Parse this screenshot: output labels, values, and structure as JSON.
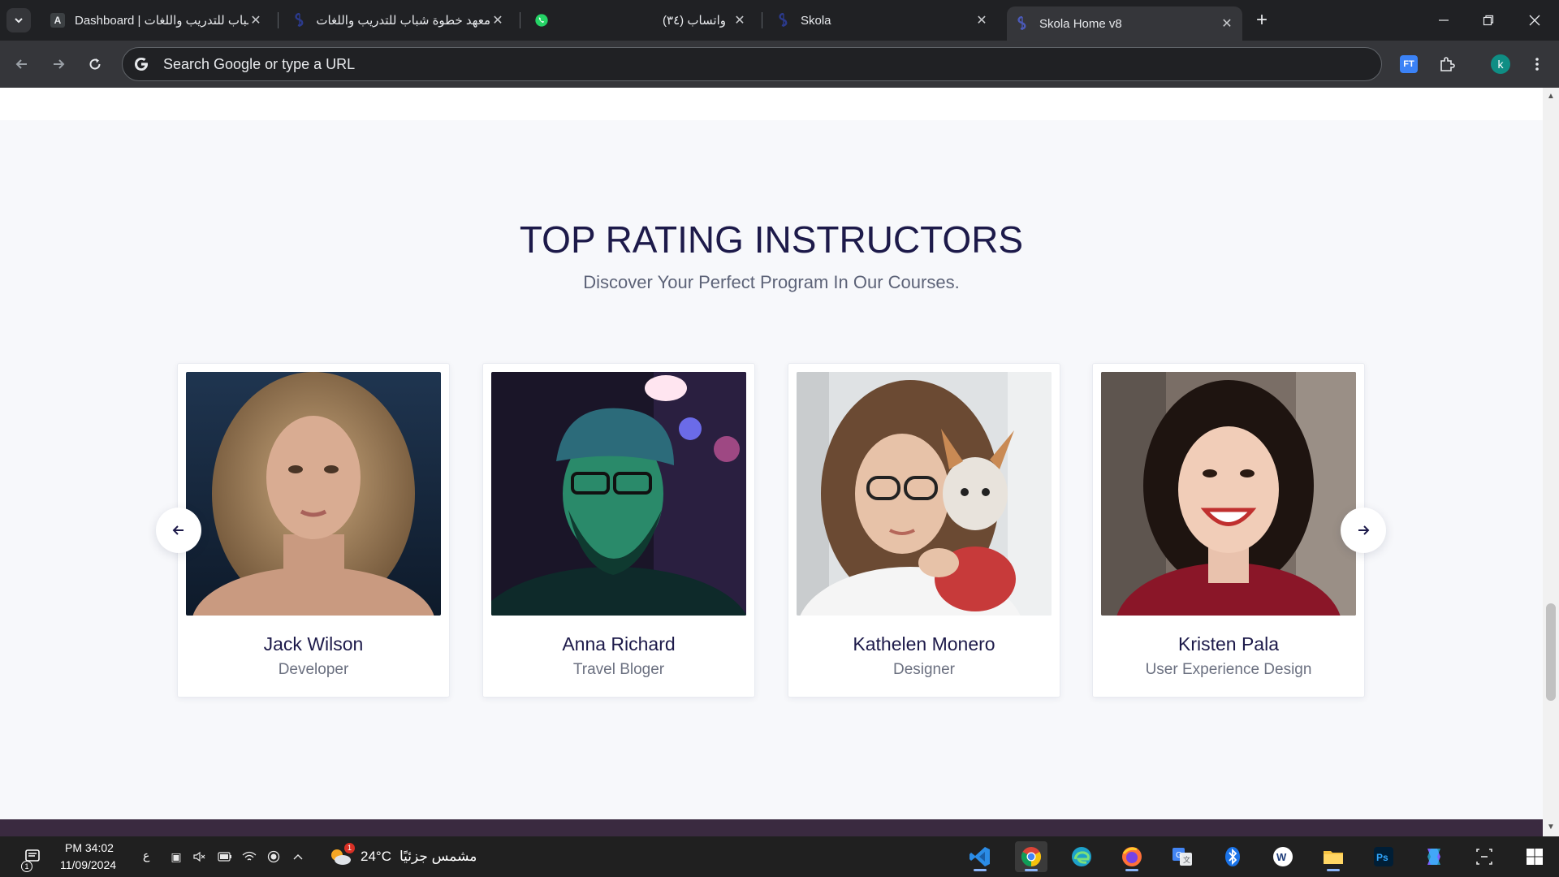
{
  "browser": {
    "tabs": [
      {
        "title": "Dashboard | معهد خطوة شباب للتدريب واللغات",
        "favicon": "A",
        "active": false
      },
      {
        "title": "معهد خطوة شباب للتدريب واللغات",
        "favicon": "skola-icon",
        "active": false
      },
      {
        "title": "(٣٤) واتساب",
        "favicon": "whatsapp-icon",
        "active": false
      },
      {
        "title": "Skola",
        "favicon": "skola-icon",
        "active": false
      },
      {
        "title": "Skola Home v8",
        "favicon": "skola-icon",
        "active": true
      }
    ],
    "address_placeholder": "Search Google or type a URL",
    "profile_initial": "k"
  },
  "section": {
    "title": "TOP RATING INSTRUCTORS",
    "subtitle": "Discover Your Perfect Program In Our Courses."
  },
  "instructors": [
    {
      "name": "Jack Wilson",
      "role": "Developer"
    },
    {
      "name": "Anna Richard",
      "role": "Travel Bloger"
    },
    {
      "name": "Kathelen Monero",
      "role": "Designer"
    },
    {
      "name": "Kristen Pala",
      "role": "User Experience Design"
    }
  ],
  "taskbar": {
    "time": "PM 34:02",
    "date": "11/09/2024",
    "notification_count": "1",
    "language": "ع",
    "weather_temp": "24°C",
    "weather_text": "مشمس جزئيًا",
    "weather_badge": "1"
  },
  "colors": {
    "heading": "#1d1a4a",
    "browser_bg": "#202124",
    "toolbar_bg": "#35363a",
    "page_bg": "#f7f8fb"
  }
}
